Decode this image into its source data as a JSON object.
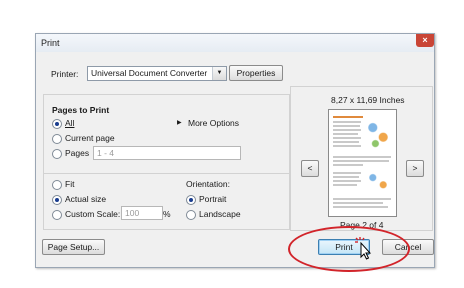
{
  "window": {
    "title": "Print",
    "close_icon": "×"
  },
  "printer": {
    "label": "Printer:",
    "value": "Universal Document Converter",
    "properties_label": "Properties"
  },
  "pages_to_print": {
    "heading": "Pages to Print",
    "options": [
      "All",
      "Current page",
      "Pages"
    ],
    "selected": "All",
    "pages_value": "1 - 4",
    "more_options_label": "More Options"
  },
  "sizing": {
    "options": [
      "Fit",
      "Actual size",
      "Custom Scale:"
    ],
    "selected": "Actual size",
    "custom_scale_value": "100",
    "percent": "%"
  },
  "orientation": {
    "heading": "Orientation:",
    "options": [
      "Portrait",
      "Landscape"
    ],
    "selected": "Portrait"
  },
  "preview": {
    "size_label": "8,27 x 11,69 Inches",
    "page_label": "Page 2 of 4",
    "prev_icon": "<",
    "next_icon": ">"
  },
  "buttons": {
    "page_setup": "Page Setup...",
    "print": "Print",
    "cancel": "Cancel"
  },
  "colors": {
    "annotation_ring": "#d2242a",
    "close_button": "#c94536"
  }
}
